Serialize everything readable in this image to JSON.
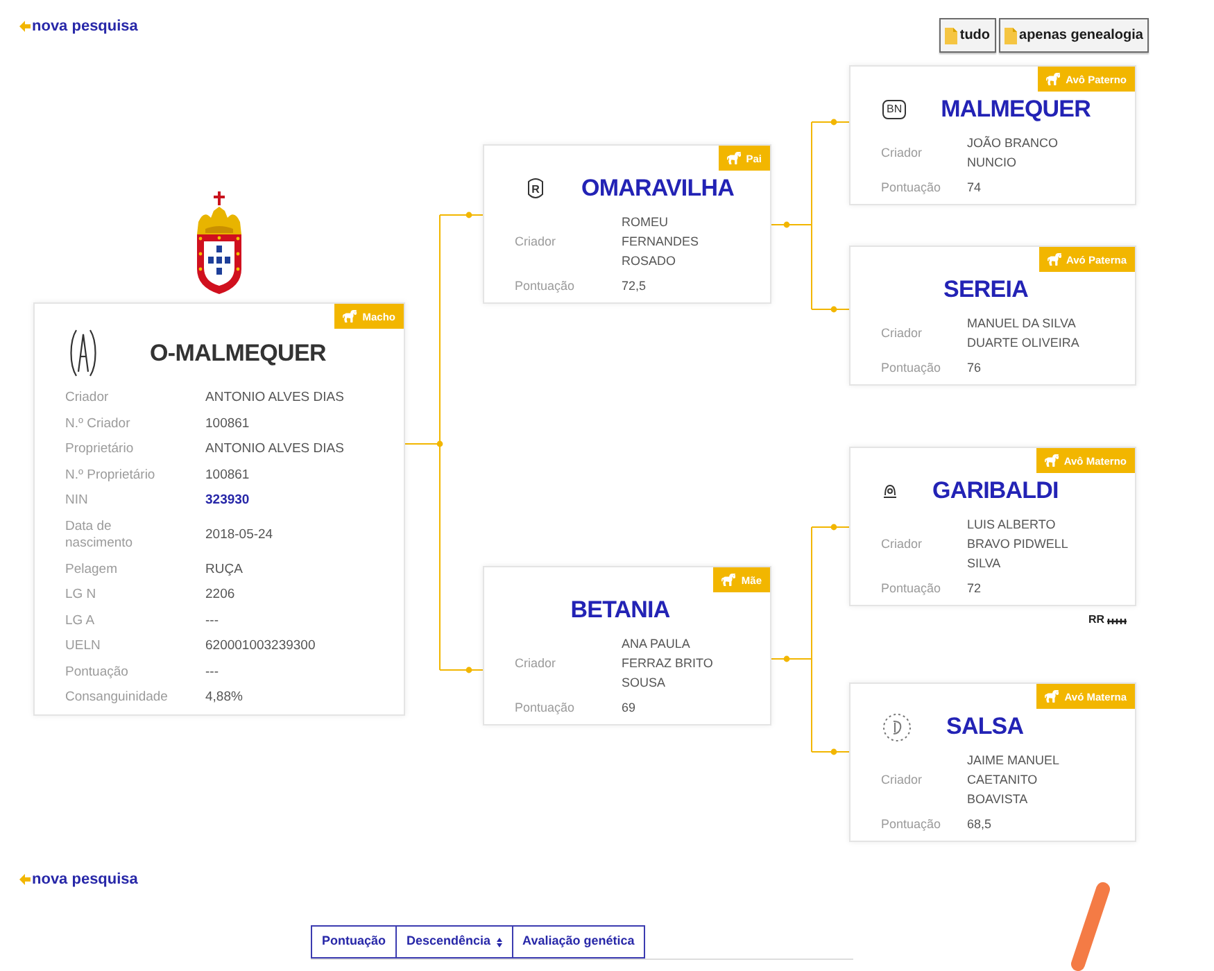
{
  "header": {
    "link": {
      "label": "nova pesquisa"
    },
    "view_buttons": [
      {
        "label": "tudo"
      },
      {
        "label": "apenas genealogia"
      }
    ]
  },
  "subject": {
    "role": "Macho",
    "name": "O-MALMEQUER",
    "brand": {
      "kind": "monogram"
    },
    "fields": [
      {
        "label": "Criador",
        "value": "ANTONIO ALVES DIAS",
        "kind": "text"
      },
      {
        "label": "N.º Criador",
        "value": "100861",
        "kind": "text"
      },
      {
        "label": "Proprietário",
        "value": "ANTONIO ALVES DIAS",
        "kind": "text"
      },
      {
        "label": "N.º Proprietário",
        "value": "100861",
        "kind": "text"
      },
      {
        "label": "NIN",
        "value": "323930",
        "kind": "link"
      },
      {
        "label": "Data de nascimento",
        "value": "2018-05-24",
        "kind": "text"
      },
      {
        "label": "Pelagem",
        "value": "RUÇA",
        "kind": "text"
      },
      {
        "label": "LG N",
        "value": "2206",
        "kind": "text"
      },
      {
        "label": "LG A",
        "value": "---",
        "kind": "text"
      },
      {
        "label": "UELN",
        "value": "620001003239300",
        "kind": "text"
      },
      {
        "label": "Pontuação",
        "value": "---",
        "kind": "text"
      },
      {
        "label": "Consanguinidade",
        "value": "4,88%",
        "kind": "text"
      }
    ]
  },
  "parents": [
    {
      "role": "Pai",
      "name": "OMARAVILHA",
      "brand": {
        "kind": "shield",
        "text": "R"
      },
      "fields": [
        {
          "label": "Criador",
          "value": "ROMEU FERNANDES ROSADO"
        },
        {
          "label": "Pontuação",
          "value": "72,5"
        }
      ]
    },
    {
      "role": "Mãe",
      "name": "BETANIA",
      "fields": [
        {
          "label": "Criador",
          "value": "ANA PAULA FERRAZ BRITO SOUSA"
        },
        {
          "label": "Pontuação",
          "value": "69"
        }
      ]
    }
  ],
  "grandparents": [
    {
      "role": "Avô Paterno",
      "name": "MALMEQUER",
      "brand": {
        "kind": "boxed",
        "text": "BN"
      },
      "fields": [
        {
          "label": "Criador",
          "value": "JOÃO BRANCO NUNCIO"
        },
        {
          "label": "Pontuação",
          "value": "74"
        }
      ]
    },
    {
      "role": "Avó Paterna",
      "name": "SEREIA",
      "fields": [
        {
          "label": "Criador",
          "value": "MANUEL DA SILVA DUARTE OLIVEIRA"
        },
        {
          "label": "Pontuação",
          "value": "76"
        }
      ]
    },
    {
      "role": "Avô Materno",
      "name": "GARIBALDI",
      "brand": {
        "kind": "emblem"
      },
      "fields": [
        {
          "label": "Criador",
          "value": "LUIS ALBERTO BRAVO PIDWELL SILVA"
        },
        {
          "label": "Pontuação",
          "value": "72"
        }
      ],
      "note": {
        "text": "RR"
      }
    },
    {
      "role": "Avó Materna",
      "name": "SALSA",
      "brand": {
        "kind": "seal"
      },
      "fields": [
        {
          "label": "Criador",
          "value": "JAIME MANUEL CAETANITO BOAVISTA"
        },
        {
          "label": "Pontuação",
          "value": "68,5"
        }
      ]
    }
  ],
  "footer": {
    "link": {
      "label": "nova pesquisa"
    }
  },
  "tabs": [
    {
      "label": "Pontuação",
      "selected": false,
      "has_sort_icon": false
    },
    {
      "label": "Descendência",
      "selected": false,
      "has_sort_icon": true
    },
    {
      "label": "Avaliação genética",
      "selected": false,
      "has_sort_icon": false
    }
  ]
}
